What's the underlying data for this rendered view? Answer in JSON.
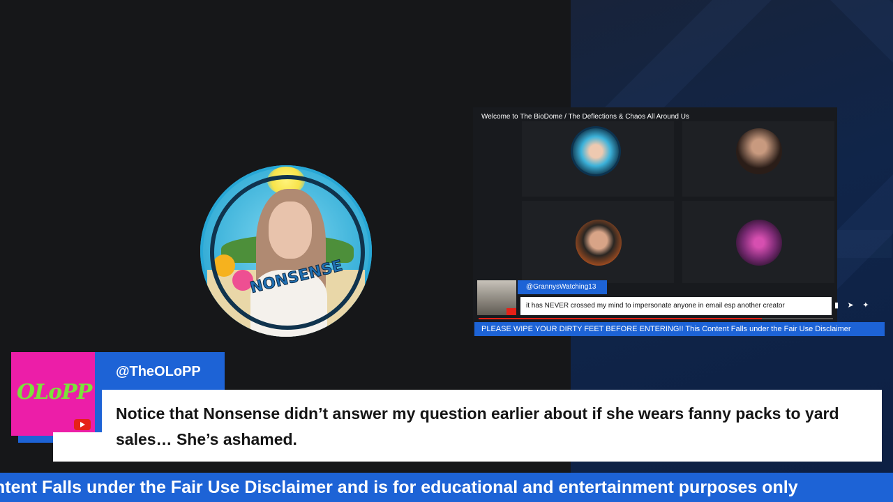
{
  "embed": {
    "title": "Welcome to The BioDome / The Deflections & Chaos All Around Us",
    "tiles": [
      {
        "name": "Nonsense avatar"
      },
      {
        "name": "woman avatar"
      },
      {
        "name": "man avatar"
      },
      {
        "name": "crown avatar"
      }
    ],
    "chat": {
      "user": "@GrannysWatching13",
      "message": "it has NEVER crossed my mind to impersonate anyone in email esp another creator"
    },
    "progress": 0.8,
    "ticker": "PLEASE WIPE YOUR DIRTY FEET BEFORE ENTERING!! This Content Falls under the Fair Use Disclaimer"
  },
  "main_avatar": {
    "label": "NONSENSE"
  },
  "overlay": {
    "avatar_text": "OLoPP",
    "username": "@TheOLoPP",
    "message": "Notice that Nonsense didn’t answer my question earlier about if she wears fanny packs to yard sales… She’s ashamed."
  },
  "ticker": {
    "text": "ntent Falls under the Fair Use Disclaimer and is for educational and entertainment purposes only"
  },
  "colors": {
    "accent_blue": "#1d63d6",
    "magenta": "#ec1ea8",
    "youtube_red": "#e62117",
    "background": "#161719"
  }
}
